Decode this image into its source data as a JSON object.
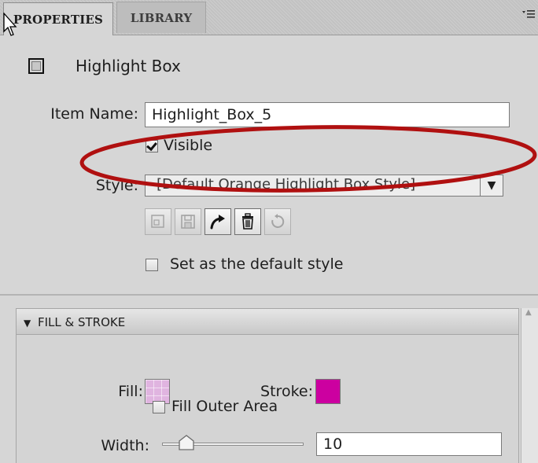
{
  "tabs": [
    {
      "label": "PROPERTIES",
      "active": true
    },
    {
      "label": "LIBRARY",
      "active": false
    }
  ],
  "panel_menu_icon": "panel-menu-icon",
  "item": {
    "icon": "highlight-box-icon",
    "title": "Highlight Box"
  },
  "form": {
    "item_name_label": "Item Name:",
    "item_name_value": "Highlight_Box_5",
    "visible_label": "Visible",
    "visible_checked": true,
    "style_label": "Style:",
    "style_value": "[Default Orange Highlight Box Style]",
    "default_style_label": "Set as the default style",
    "default_style_checked": false
  },
  "style_toolbar": [
    {
      "name": "create-style-icon",
      "enabled": false
    },
    {
      "name": "save-style-icon",
      "enabled": false
    },
    {
      "name": "redefine-style-icon",
      "enabled": true
    },
    {
      "name": "delete-style-icon",
      "enabled": true
    },
    {
      "name": "reset-style-icon",
      "enabled": false
    }
  ],
  "fill_stroke": {
    "title": "FILL & STROKE",
    "fill_label": "Fill:",
    "fill_color": "#e0b4e0",
    "stroke_label": "Stroke:",
    "stroke_color": "#cc00a0",
    "fill_outer_label": "Fill Outer Area",
    "fill_outer_checked": false,
    "width_label": "Width:",
    "width_value": "10"
  },
  "annotation_color": "#b01010"
}
